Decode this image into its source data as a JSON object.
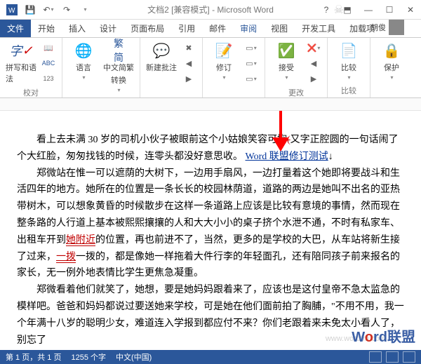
{
  "window": {
    "title": "文档2 [兼容模式] - Microsoft Word",
    "user_name": "胡俊"
  },
  "tabs": {
    "file": "文件",
    "home": "开始",
    "insert": "插入",
    "design": "设计",
    "layout": "页面布局",
    "references": "引用",
    "mail": "邮件",
    "review": "审阅",
    "view": "视图",
    "dev": "开发工具",
    "addins": "加载项"
  },
  "ribbon": {
    "spelling_big": "字A",
    "spelling_label": "拼写和语法",
    "language": "语言",
    "convert_line1": "中文简繁",
    "convert_line2": "转换",
    "comment": "新建批注",
    "track": "修订",
    "accept": "接受",
    "compare": "比较",
    "protect": "保护",
    "group_proof": "校对",
    "group_changes": "更改",
    "group_compare": "比较"
  },
  "document": {
    "p1_a": "看上去未满 30 岁的司机小伙子被眼前这个小姑娘笑容可掬",
    "p1_strike": "(",
    "p1_b": "又字正腔圆的一句话闹了个大红脸，匆匆找钱的时候，连零头都没好意思收。",
    "p1_link": "Word 联盟修订测试",
    "p1_end": "↓",
    "p2": "郑微站在惟一可以遮荫的大树下，一边用手扇风，一边打量着这个她即将要战斗和生活四年的地方。她所在的位置是一条长长的校园林荫道，道路的两边是她叫不出名的亚热带树木，可以想象黄昏的时候散步在这样一条道路上应该是比较有意境的事情，然而现在整条路的人行道上基本被熙熙攘攘的人和大大小小的桌子挤个水泄不通，不时有私家车、出租车开到",
    "p2_u1": "她附近",
    "p2_b": "的位置，再也前进不了，当然，更多的是学校的大巴，从车站将新生接了过来，",
    "p2_u2": "一拨",
    "p2_c": "一拨的，都是像她一样拖着大件行李的年轻面孔，还有陪同孩子前来报名的家长，无一例外地表情比学生更焦急凝重。",
    "p3": "郑微看着他们就笑了，她想，要是她妈妈跟着来了，应该也是这付皇帝不急太监急的模样吧。爸爸和妈妈都说过要送她来学校，可是她在他们面前拍了胸脯，\"不用不用，我一个年满十八岁的聪明少女，难道连入学报到都应付不来？你们老跟着来未免太小看人了，别忘了"
  },
  "statusbar": {
    "page": "第 1 页，共 1 页",
    "words": "1255 个字",
    "lang": "中文(中国)"
  },
  "watermark": {
    "brand_a": "W",
    "brand_b": "o",
    "brand_c": "rd联盟",
    "url": "www.wordfm.com"
  }
}
